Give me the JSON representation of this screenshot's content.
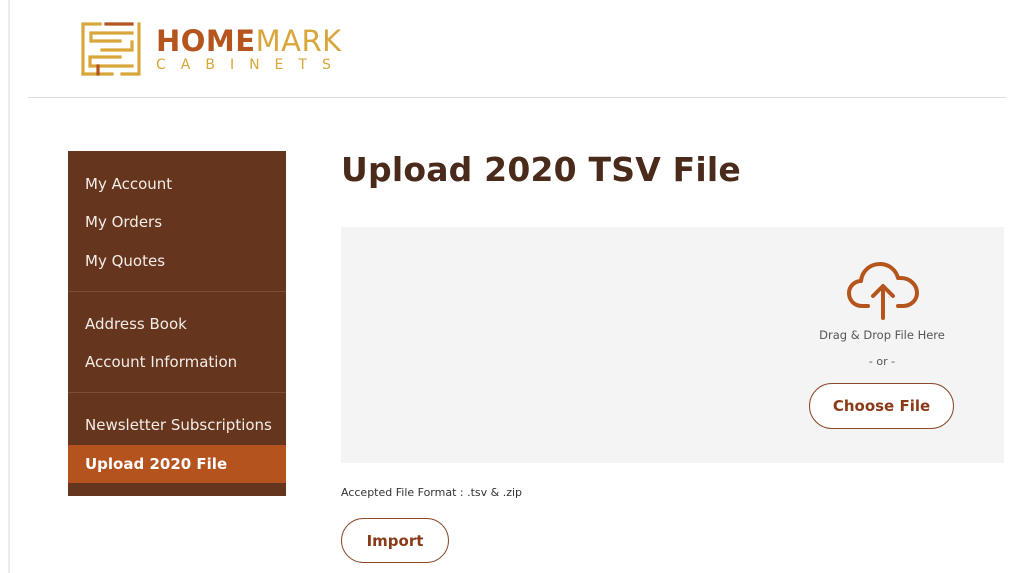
{
  "brand": {
    "name_bold": "HOME",
    "name_light": "MARK",
    "subtitle": "CABINETS",
    "colors": {
      "primary": "#b5541d",
      "gold": "#d9a63a"
    }
  },
  "sidebar": {
    "background": "#66351d",
    "active_color": "#b4531e",
    "groups": [
      {
        "items": [
          {
            "label": "My Account"
          },
          {
            "label": "My Orders"
          },
          {
            "label": "My Quotes"
          }
        ]
      },
      {
        "items": [
          {
            "label": "Address Book"
          },
          {
            "label": "Account Information"
          }
        ]
      },
      {
        "items": [
          {
            "label": "Newsletter Subscriptions"
          },
          {
            "label": "Upload 2020 File",
            "active": true
          }
        ]
      }
    ]
  },
  "main": {
    "title": "Upload 2020 TSV File",
    "dropzone": {
      "icon": "cloud-upload-icon",
      "drag_text": "Drag & Drop File Here",
      "or_text": "- or -",
      "choose_label": "Choose File"
    },
    "accepted_formats": "Accepted File Format : .tsv & .zip",
    "import_label": "Import"
  }
}
